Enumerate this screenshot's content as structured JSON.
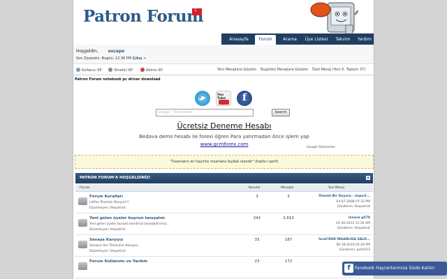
{
  "header": {
    "logo_text": "Patron Forum",
    "nav": [
      {
        "label": "Anasayfa"
      },
      {
        "label": "Forum"
      },
      {
        "label": "Arama"
      },
      {
        "label": "Üye Listesi"
      },
      {
        "label": "Takvim"
      },
      {
        "label": "Yardım"
      }
    ]
  },
  "userbar": {
    "welcome": "Hoşgeldin,",
    "username": "escape",
    "last_visit": "Son Ziyaretin: Bugün, 12:36 PM",
    "logout": "Çıkış"
  },
  "panel": {
    "user_cp": "Kullanıcı KP",
    "mod_cp": "Yönetici KP",
    "admin_cp": "Admin KP",
    "new_posts": "Yeni Mesajlara Gözatın",
    "todays_posts": "Bugünkü Mesajlara Gözatın",
    "pm": "Özel Mesaj",
    "pm_counts": "(Yeni 0, Toplam 37)"
  },
  "page_title": "Patron Forum notebook pc driver download",
  "social": {
    "twitter_icon": "twitter-icon",
    "youtube_icon": "youtube-icon",
    "facebook_icon": "facebook-icon",
    "youtube_text": "You Tube"
  },
  "search": {
    "placeholder": "Google™ Özel Arama",
    "button": "Search"
  },
  "ad": {
    "title": "Ücretsiz Deneme Hesabı",
    "text": "Bedava demo hesabı ile forexi öğren Para yatırmadan önce işlem yap",
    "link": "www.gcmforex.com",
    "google": "Google Reklamları"
  },
  "notice": "\"İnsanların en hayırlısı insanlara faydalı olandır\" (hadis-i şerif)",
  "forumbox": {
    "title": "PATRON FORUM'A HOŞGELDİNİZ!",
    "columns": {
      "forum": "Forum",
      "topics": "Konular",
      "posts": "Mesajlar",
      "last": "Son Mesaj"
    },
    "rows": [
      {
        "name": "Forum Kuralları",
        "desc": "Lütfen Önemle Okuyun!!!",
        "mod": "Düzenleyen: thepatriot",
        "topics": "3",
        "posts": "3",
        "last_title": "Önemli Bir Duyuru - import...",
        "last_date": "03-07-2008 07:32 PM",
        "last_by": "Gönderen: thepatriot"
      },
      {
        "name": "Yeni gelen üyeler buyrun tanışalım",
        "desc": "Yeni gelen üyeler burada kendinizi tanıtabilirsiniz...",
        "mod": "Düzenleyen: thepatriot",
        "topics": "242",
        "posts": "2,610",
        "last_title": "lenava g570",
        "last_date": "10-30-2012 11:36 AM",
        "last_by": "Gönderen: thepatriot"
      },
      {
        "name": "Savaşa Karşıyız",
        "desc": "Savaşın Her Türlüsüne Karşıyız...",
        "mod": "Düzenleyen: thepatriot",
        "topics": "33",
        "posts": "187",
        "last_title": "İsrail'DEN İNSANLIĞA SALD...",
        "last_date": "06-18-2010 05:29 PM",
        "last_by": "Gönderen: politic53"
      },
      {
        "name": "Forum Kullanımı ve Yardım",
        "desc": "",
        "mod": "",
        "topics": "23",
        "posts": "172",
        "last_title": "",
        "last_date": "",
        "last_by": ""
      }
    ]
  },
  "facebook_popup": "Facebook Hayranlarımıza Sizde Katılın",
  "colors": {
    "brand": "#2e5a86",
    "nav": "#1f3f62",
    "facebook": "#3b5998"
  }
}
